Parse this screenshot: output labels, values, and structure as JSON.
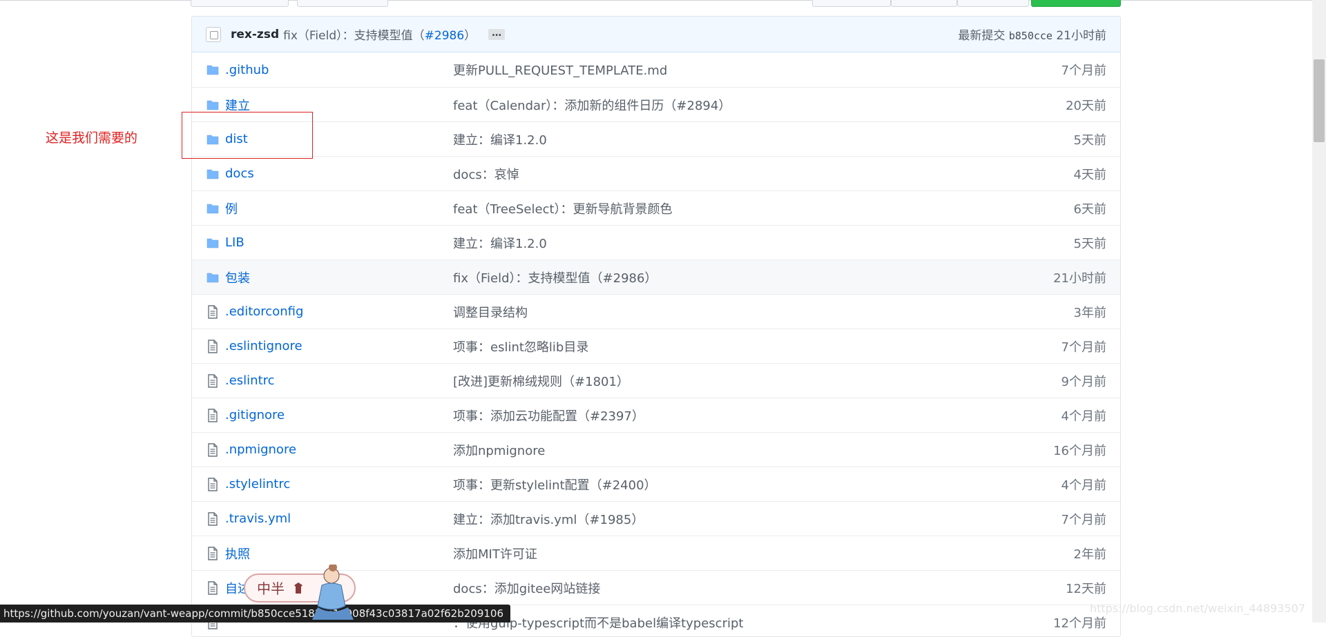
{
  "annotation": {
    "text": "这是我们需要的"
  },
  "commit": {
    "author": "rex-zsd",
    "message_prefix": "fix（Field）：支持模型值（",
    "pr_link": "#2986",
    "message_suffix": "）",
    "ellipsis": "…",
    "latest_label": "最新提交",
    "sha": "b850cce",
    "time": "21小时前"
  },
  "files": [
    {
      "icon": "folder-icon",
      "name": ".github",
      "message": "更新PULL_REQUEST_TEMPLATE.md",
      "age": "7个月前"
    },
    {
      "icon": "folder-icon",
      "name": "建立",
      "message": "feat（Calendar）：添加新的组件日历（#2894）",
      "age": "20天前"
    },
    {
      "icon": "folder-icon",
      "name": "dist",
      "message": "建立：编译1.2.0",
      "age": "5天前"
    },
    {
      "icon": "folder-icon",
      "name": "docs",
      "message": "docs：哀悼",
      "age": "4天前"
    },
    {
      "icon": "folder-icon",
      "name": "例",
      "message": "feat（TreeSelect）：更新导航背景颜色",
      "age": "6天前"
    },
    {
      "icon": "folder-icon",
      "name": "LIB",
      "message": "建立：编译1.2.0",
      "age": "5天前"
    },
    {
      "icon": "folder-icon",
      "name": "包装",
      "message": "fix（Field）：支持模型值（#2986）",
      "age": "21小时前"
    },
    {
      "icon": "file-icon",
      "name": ".editorconfig",
      "message": "调整目录结构",
      "age": "3年前"
    },
    {
      "icon": "file-icon",
      "name": ".eslintignore",
      "message": "项事：eslint忽略lib目录",
      "age": "7个月前"
    },
    {
      "icon": "file-icon",
      "name": ".eslintrc",
      "message": "[改进]更新棉绒规则（#1801）",
      "age": "9个月前"
    },
    {
      "icon": "file-icon",
      "name": ".gitignore",
      "message": "项事：添加云功能配置（#2397）",
      "age": "4个月前"
    },
    {
      "icon": "file-icon",
      "name": ".npmignore",
      "message": "添加npmignore",
      "age": "16个月前"
    },
    {
      "icon": "file-icon",
      "name": ".stylelintrc",
      "message": "项事：更新stylelint配置（#2400）",
      "age": "4个月前"
    },
    {
      "icon": "file-icon",
      "name": ".travis.yml",
      "message": "建立：添加travis.yml（#1985）",
      "age": "7个月前"
    },
    {
      "icon": "file-icon",
      "name": "执照",
      "message": "添加MIT许可证",
      "age": "2年前"
    },
    {
      "icon": "file-icon",
      "name": "自述",
      "message": "docs：添加gitee网站链接",
      "age": "12天前"
    },
    {
      "icon": "file-icon",
      "name": "",
      "message": "：使用gulp-typescript而不是babel编译typescript",
      "age": "12个月前"
    }
  ],
  "status_bar": {
    "url": "https://github.com/youzan/vant-weapp/commit/b850cce5182cc1a908f43c03817a02f62b209106"
  },
  "watermark": {
    "text": "https://blog.csdn.net/weixin_44893507"
  },
  "mascot": {
    "text": "中半"
  },
  "colors": {
    "link": "#0366d6",
    "annotation": "#e02020",
    "commit_bar": "#f1f8ff"
  }
}
